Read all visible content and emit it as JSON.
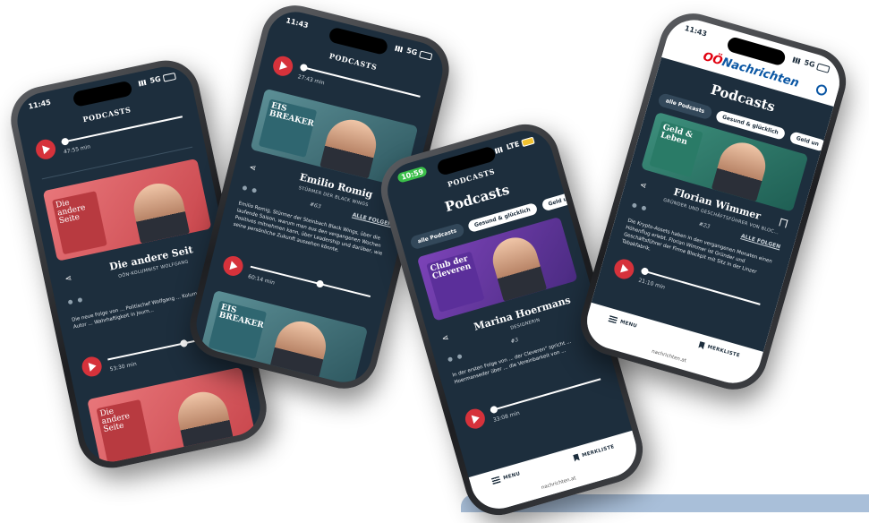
{
  "colors": {
    "dark_bg": "#1d2e3d",
    "accent_red": "#d6323b",
    "brand_red": "#e1000f",
    "brand_blue": "#0b57a4"
  },
  "phone1": {
    "time": "11:45",
    "network": "5G",
    "header": "PODCASTS",
    "player1_time": "47:55 min",
    "cover_text": "Die andere Seite",
    "title": "Die andere Seit",
    "subtitle": "OÖN-KOLUMNIST WOLFGANG",
    "desc": "Die neue Folge von ... Politischef Wolfgang ... Kolumnist und Autor ... Wahrhaftigkeit in Journ...",
    "player2_time": "53:30 min",
    "cover2_text": "Die andere Seite"
  },
  "phone2": {
    "time": "11:43",
    "network": "5G",
    "header": "PODCASTS",
    "player1_time": "27:43 min",
    "cover_text": "EIS BREAKER",
    "title": "Emilio Romig",
    "subtitle": "STÜRMER DER BLACK WINGS",
    "episode": "#63",
    "all_episodes": "ALLE FOLGEN",
    "desc": "Emilio Romig, Stürmer der Steinbach Black Wings, über die laufende Saison, warum man aus den vergangenen Wochen Positives mitnehmen kann, über Leadership und darüber, wie seine persönliche Zukunft aussehen könnte.",
    "player2_time": "60:14 min",
    "cover2_text": "EIS BREAKER"
  },
  "phone3": {
    "time": "10:59",
    "network": "LTE",
    "header": "PODCASTS",
    "title_big": "Podcasts",
    "chips": [
      "alle Podcasts",
      "Gesund & glücklich",
      "Geld un"
    ],
    "cover_text": "Club der Cleveren",
    "title": "Marina Hoermans",
    "subtitle": "DESIGNERIN",
    "episode": "#3",
    "desc": "In der ersten Folge von ... der Cleveren\" spricht ... Hoermanseder über ... die Vereinbarkeit von ...",
    "player_time": "33:08 min",
    "nav_menu": "MENU",
    "nav_bookmarks": "MERKLISTE",
    "url": "nachrichten.at"
  },
  "phone4": {
    "time": "11:43",
    "network": "5G",
    "logo_prefix": "OÖ",
    "logo_main": "Nachrichten",
    "title_big": "Podcasts",
    "chips": [
      "alle Podcasts",
      "Gesund & glücklich",
      "Geld un"
    ],
    "cover_text": "Geld & Leben",
    "title": "Florian Wimmer",
    "subtitle": "GRÜNDER UND GESCHÄFTSFÜHRER VON BLOC...",
    "episode": "#23",
    "all_episodes": "ALLE FOLGEN",
    "desc": "Die Krypto-Assets haben in den vergangenen Monaten einen Höhenflug erlebt. Florian Wimmer ist Gründer und Geschäftsführer der Firma Blockpit mit Sitz in der Linzer Tabakfabrik.",
    "player_time": "21:10 min",
    "nav_menu": "MENU",
    "nav_bookmarks": "MERKLISTE",
    "url": "nachrichten.at"
  }
}
